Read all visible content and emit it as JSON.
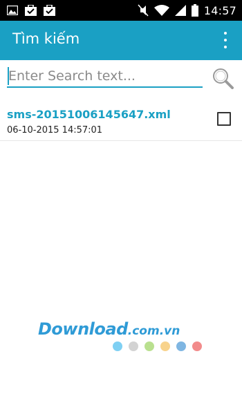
{
  "status_bar": {
    "time": "14:57",
    "icons_left": [
      "image-icon",
      "briefcase-check-icon",
      "briefcase-check-icon"
    ],
    "icons_right": [
      "mute-icon",
      "wifi-icon",
      "signal-icon",
      "battery-icon"
    ]
  },
  "action_bar": {
    "title": "Tìm kiếm",
    "menu_icon": "overflow-menu-icon",
    "color": "#1aa0c4"
  },
  "search": {
    "placeholder": "Enter Search text...",
    "value": "",
    "button_icon": "search-icon"
  },
  "results": [
    {
      "name": "sms-20151006145647.xml",
      "date": "06-10-2015 14:57:01",
      "checked": false
    }
  ],
  "watermark": {
    "text": "Download",
    "suffix": ".com.vn",
    "dot_colors": [
      "#7fd0f3",
      "#d3d3d3",
      "#b9e08f",
      "#f8d38c",
      "#7fb6e2",
      "#f28b8b"
    ]
  }
}
